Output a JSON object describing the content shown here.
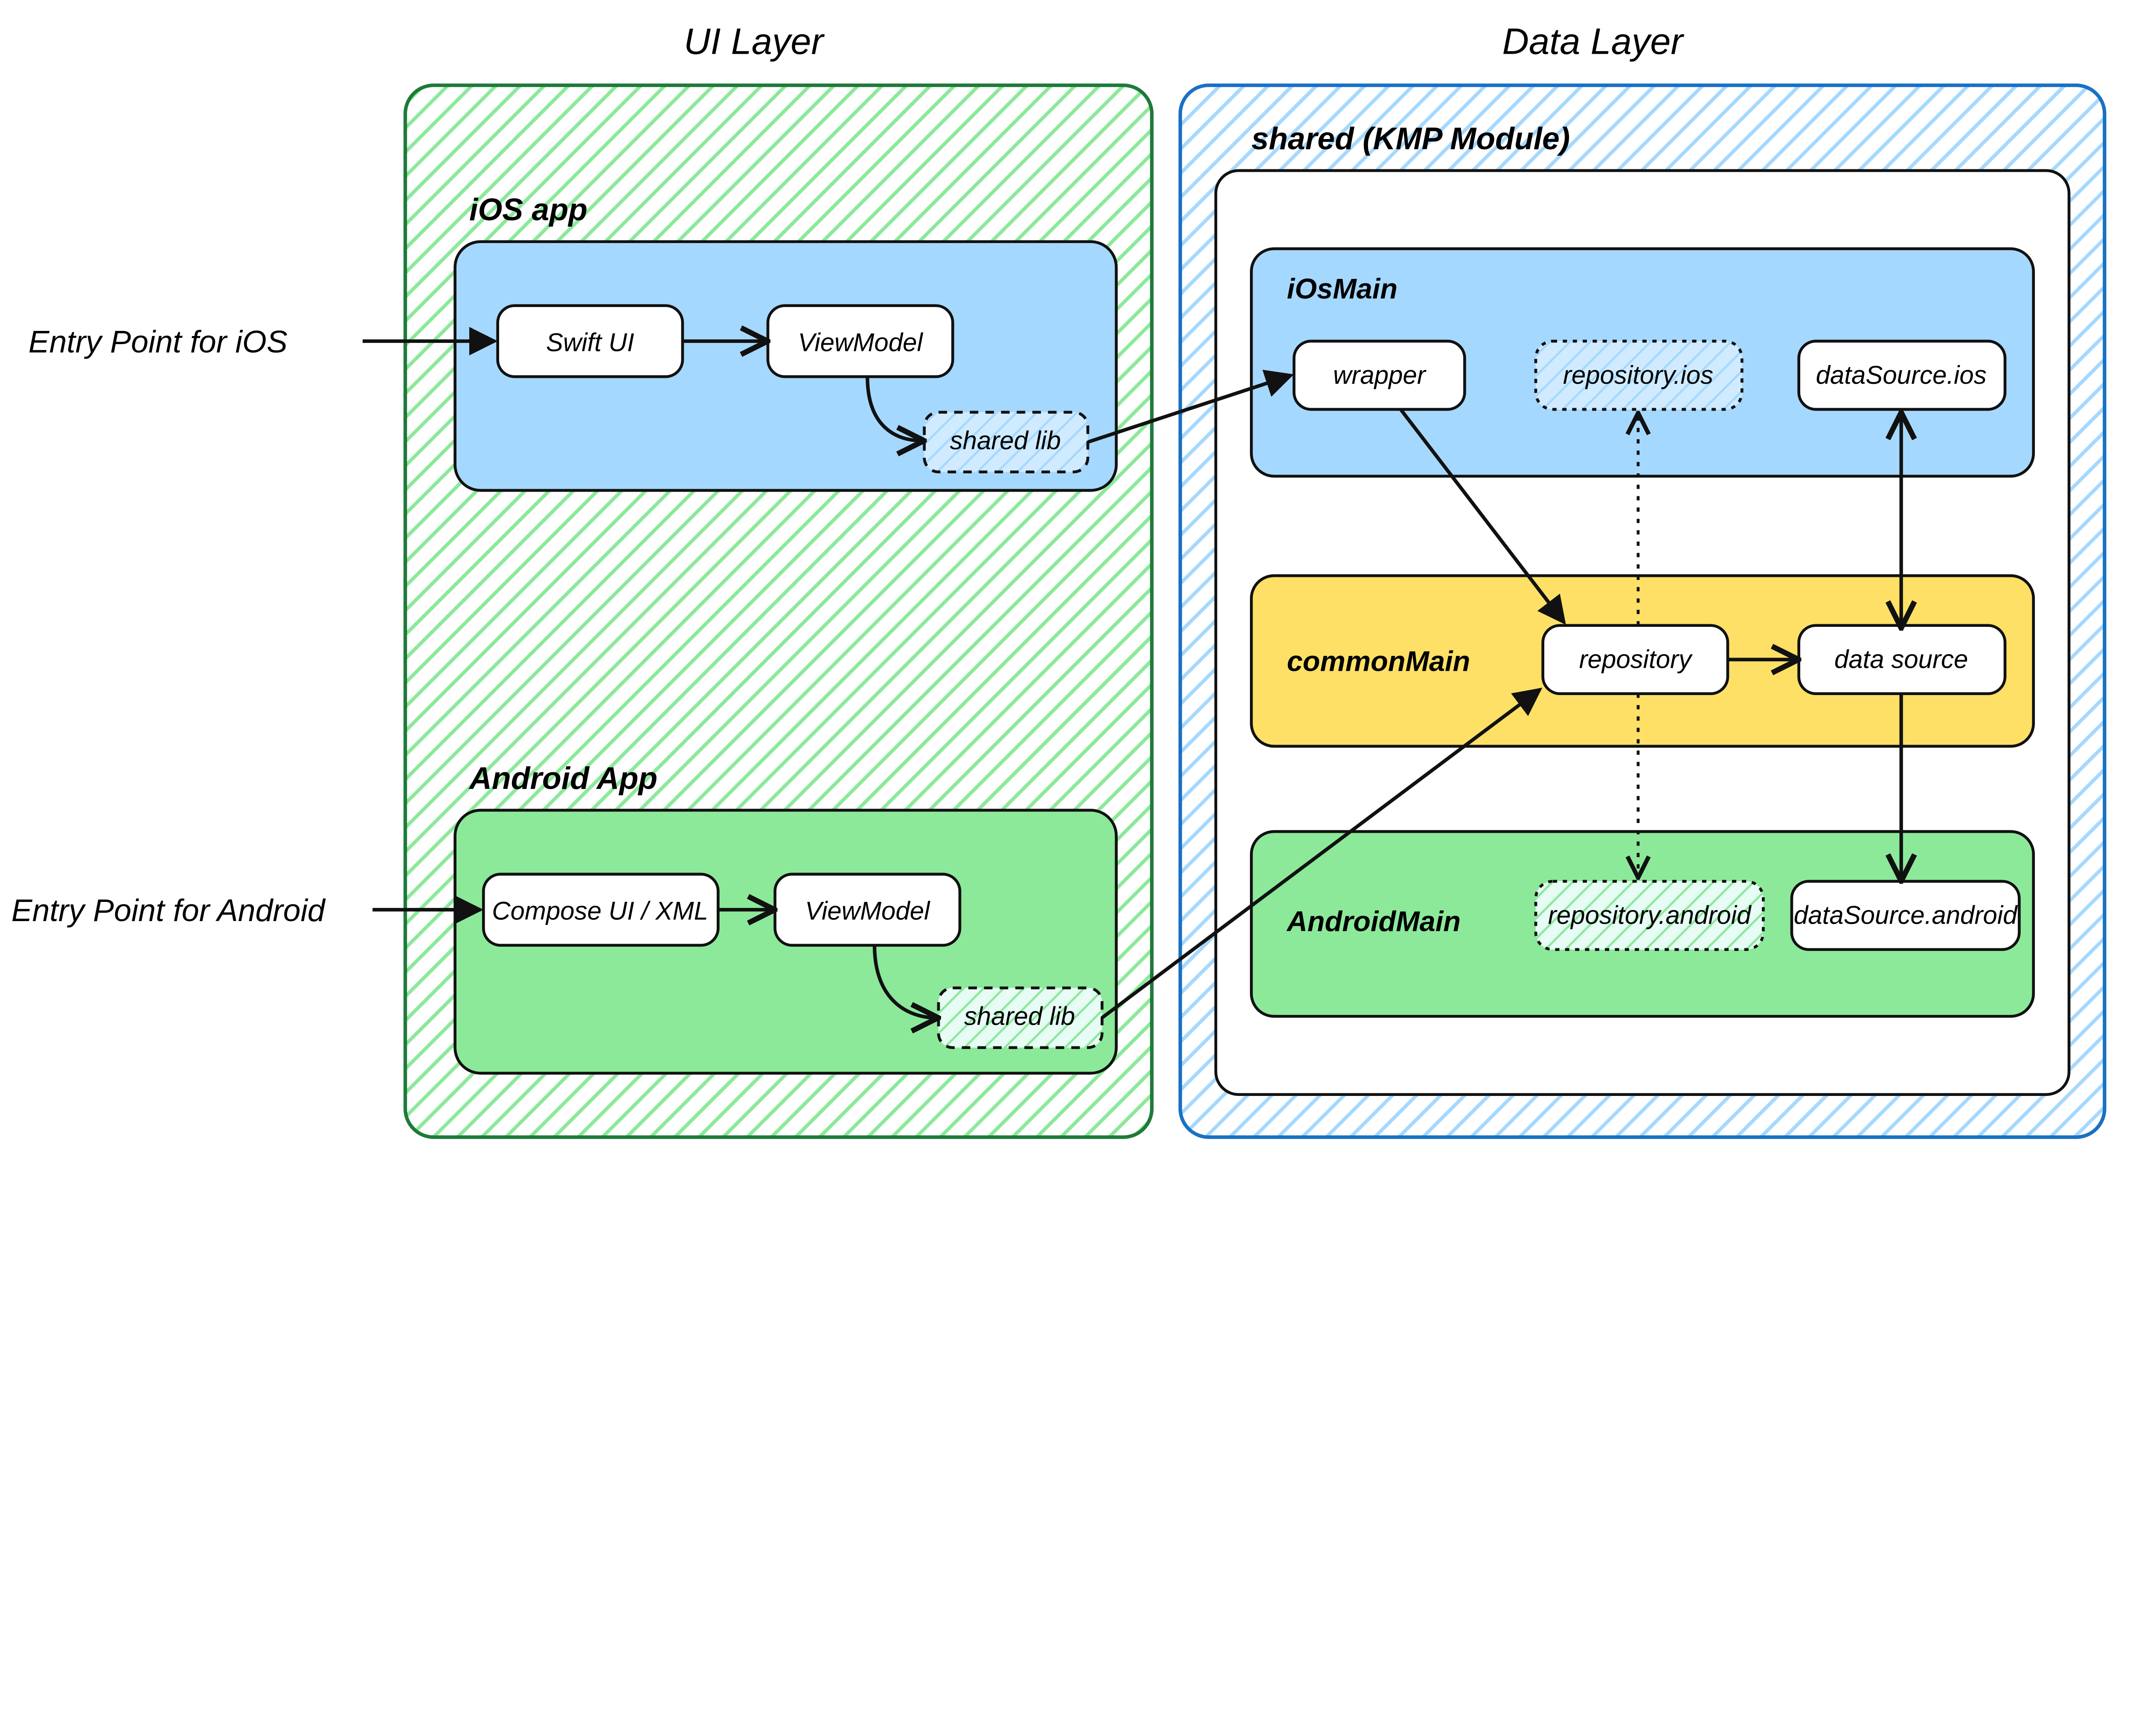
{
  "headers": {
    "ui_layer": "UI Layer",
    "data_layer": "Data Layer"
  },
  "entries": {
    "ios": "Entry Point for iOS",
    "android": "Entry Point for Android"
  },
  "ui": {
    "ios": {
      "title": "iOS app",
      "swift_ui": "Swift UI",
      "viewmodel": "ViewModel",
      "shared_lib": "shared lib"
    },
    "android": {
      "title": "Android App",
      "compose": "Compose UI / XML",
      "viewmodel": "ViewModel",
      "shared_lib": "shared lib"
    }
  },
  "data": {
    "shared_title": "shared (KMP Module)",
    "iosmain": {
      "title": "iOsMain",
      "wrapper": "wrapper",
      "repo": "repository.ios",
      "ds": "dataSource.ios"
    },
    "common": {
      "title": "commonMain",
      "repo": "repository",
      "ds": "data source"
    },
    "androidmain": {
      "title": "AndroidMain",
      "repo": "repository.android",
      "ds": "dataSource.android"
    }
  },
  "colors": {
    "green_fill": "#8ce99a",
    "green_stroke": "#1f7a3a",
    "blue_fill": "#a5d8ff",
    "blue_stroke": "#1971c2",
    "yellow_fill": "#ffe066",
    "yellow_stroke": "#b88700",
    "white": "#ffffff",
    "ink": "#111111"
  }
}
